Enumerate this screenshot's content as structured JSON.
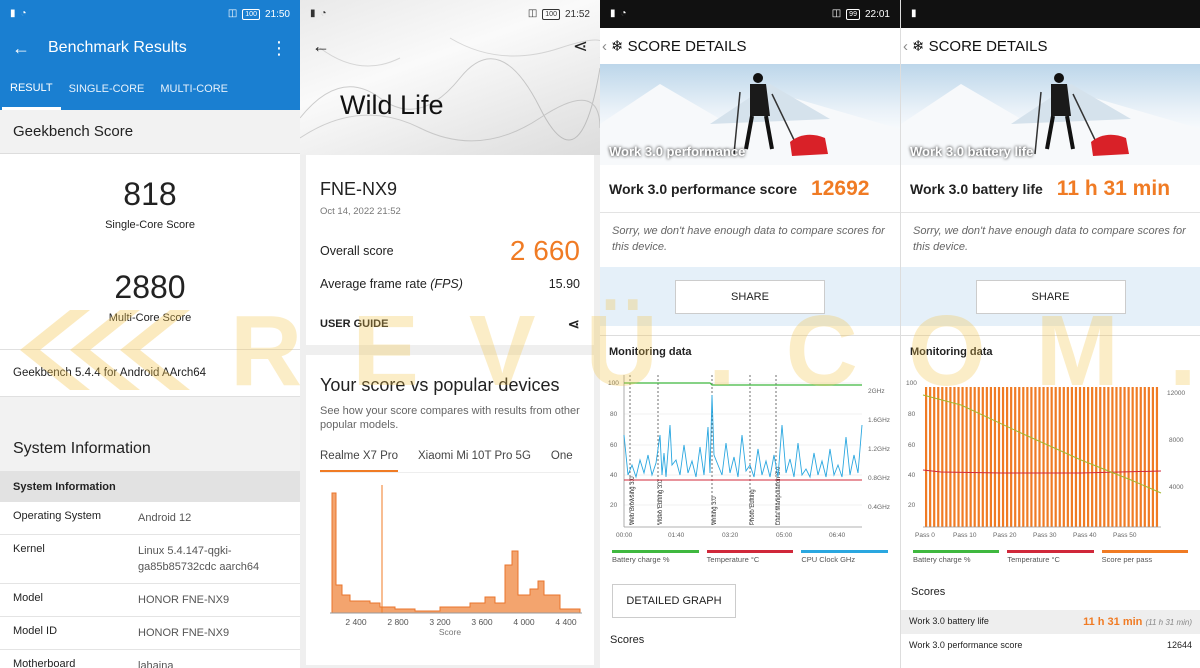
{
  "panel1": {
    "status": {
      "time": "21:50",
      "battery": "100"
    },
    "title": "Benchmark Results",
    "tabs": [
      "RESULT",
      "SINGLE-CORE",
      "MULTI-CORE"
    ],
    "section": "Geekbench Score",
    "single_score": "818",
    "single_label": "Single-Core Score",
    "multi_score": "2880",
    "multi_label": "Multi-Core Score",
    "version": "Geekbench 5.4.4 for Android AArch64",
    "sysinfo_title": "System Information",
    "sysinfo_sub": "System Information",
    "rows": [
      {
        "k": "Operating System",
        "v": "Android 12"
      },
      {
        "k": "Kernel",
        "v": "Linux 5.4.147-qgki-ga85b85732cdc aarch64"
      },
      {
        "k": "Model",
        "v": "HONOR FNE-NX9"
      },
      {
        "k": "Model ID",
        "v": "HONOR FNE-NX9"
      },
      {
        "k": "Motherboard",
        "v": "lahaina"
      }
    ]
  },
  "panel2": {
    "status": {
      "time": "21:52",
      "battery": "100"
    },
    "title": "Wild Life",
    "device": "FNE-NX9",
    "date": "Oct 14, 2022 21:52",
    "overall_label": "Overall score",
    "overall_value": "2 660",
    "fps_label": "Average frame rate",
    "fps_unit": "(FPS)",
    "fps_value": "15.90",
    "guide": "USER GUIDE",
    "vs_title": "Your score vs popular devices",
    "vs_sub": "See how your score compares with results from other popular models.",
    "tabs": [
      "Realme X7 Pro",
      "Xiaomi Mi 10T Pro 5G",
      "One"
    ],
    "xticks": [
      "2 400",
      "2 800",
      "3 200",
      "3 600",
      "4 000",
      "4 400"
    ],
    "xlabel": "Score"
  },
  "panel3": {
    "status": {
      "time": "22:01",
      "battery": "99"
    },
    "header": "SCORE DETAILS",
    "hero_caption": "Work 3.0 performance",
    "score_label": "Work 3.0 performance score",
    "score_value": "12692",
    "sorry": "Sorry, we don't have enough data to compare scores for this device.",
    "share": "SHARE",
    "monitoring": "Monitoring data",
    "yticks_left": [
      "100",
      "80",
      "60",
      "40",
      "20"
    ],
    "yticks_right": [
      "2GHz",
      "1.6GHz",
      "1.2GHz",
      "0.8GHz",
      "0.4GHz"
    ],
    "xticks": [
      "00:00",
      "01:40",
      "03:20",
      "05:00",
      "06:40"
    ],
    "phases": [
      "Web Browsing 3.0",
      "Video Editing 3.0",
      "Writing 3.0",
      "Photo Editing",
      "Data Manipulation 3.0"
    ],
    "legend": [
      "Battery charge %",
      "Temperature °C",
      "CPU Clock GHz"
    ],
    "legend_colors": [
      "#3fb83f",
      "#d0283a",
      "#2aa7e0"
    ],
    "detailed": "DETAILED GRAPH",
    "scores": "Scores"
  },
  "panel4": {
    "header": "SCORE DETAILS",
    "hero_caption": "Work 3.0 battery life",
    "score_label": "Work 3.0 battery life",
    "score_value": "11 h 31 min",
    "sorry": "Sorry, we don't have enough data to compare scores for this device.",
    "share": "SHARE",
    "monitoring": "Monitoring data",
    "yticks_left": [
      "100",
      "80",
      "60",
      "40",
      "20"
    ],
    "yticks_right": [
      "12000",
      "8000",
      "4000"
    ],
    "xticks": [
      "Pass 0",
      "Pass 10",
      "Pass 20",
      "Pass 30",
      "Pass 40",
      "Pass 50"
    ],
    "legend": [
      "Battery charge %",
      "Temperature °C",
      "Score per pass"
    ],
    "legend_colors": [
      "#3fb83f",
      "#d0283a",
      "#f07b24"
    ],
    "scores": "Scores",
    "table": [
      {
        "k": "Work 3.0 battery life",
        "v": "11 h 31 min",
        "extra": "(11 h 31 min)"
      },
      {
        "k": "Work 3.0 performance score",
        "v": "12644",
        "extra": ""
      }
    ]
  },
  "watermark": "REVÜ.COM.PH"
}
